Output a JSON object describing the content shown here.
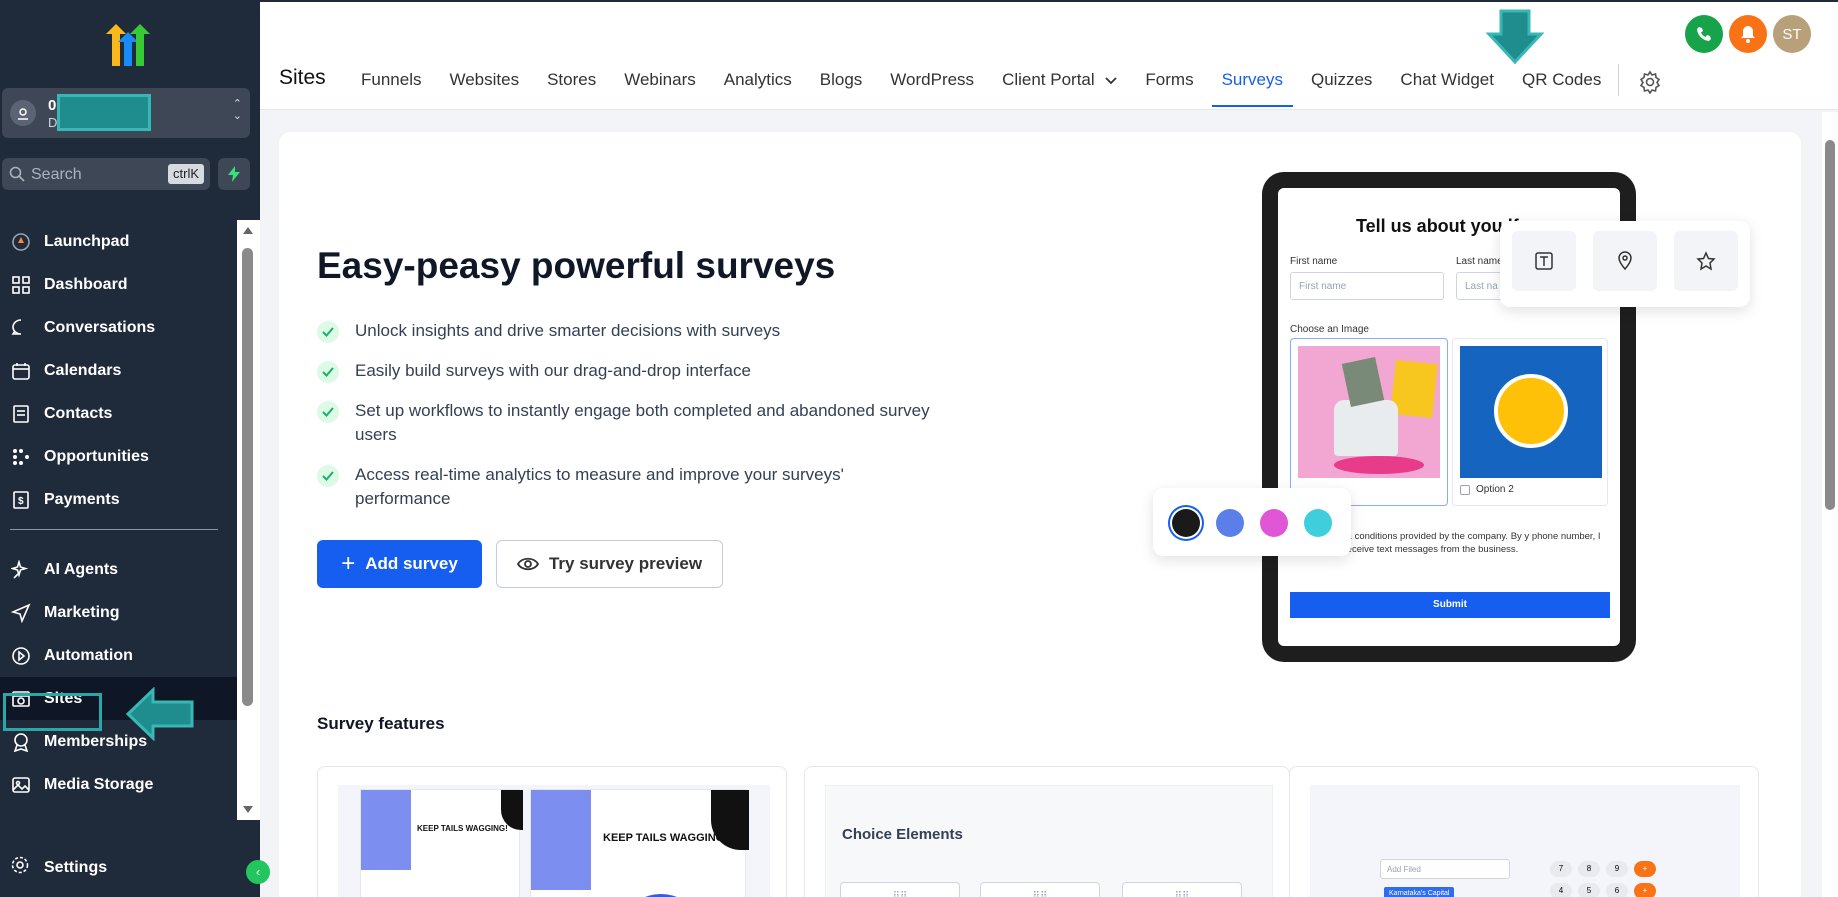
{
  "sidebar": {
    "account": {
      "name": "0",
      "sub": "D"
    },
    "search": {
      "placeholder": "Search",
      "shortcut": "ctrlK"
    },
    "items": [
      {
        "label": "Launchpad",
        "icon": "launchpad-icon"
      },
      {
        "label": "Dashboard",
        "icon": "dashboard-icon"
      },
      {
        "label": "Conversations",
        "icon": "chat-bubble-icon"
      },
      {
        "label": "Calendars",
        "icon": "calendar-icon"
      },
      {
        "label": "Contacts",
        "icon": "contacts-icon"
      },
      {
        "label": "Opportunities",
        "icon": "opportunities-icon"
      },
      {
        "label": "Payments",
        "icon": "payments-icon"
      }
    ],
    "items2": [
      {
        "label": "AI Agents",
        "icon": "ai-sparkle-icon"
      },
      {
        "label": "Marketing",
        "icon": "send-icon"
      },
      {
        "label": "Automation",
        "icon": "play-icon"
      },
      {
        "label": "Sites",
        "icon": "sites-icon",
        "active": true
      },
      {
        "label": "Memberships",
        "icon": "badge-icon"
      },
      {
        "label": "Media Storage",
        "icon": "image-icon"
      }
    ],
    "settings_label": "Settings"
  },
  "header": {
    "title": "Sites",
    "tabs": [
      "Funnels",
      "Websites",
      "Stores",
      "Webinars",
      "Analytics",
      "Blogs",
      "WordPress",
      "Client Portal",
      "Forms",
      "Surveys",
      "Quizzes",
      "Chat Widget",
      "QR Codes"
    ],
    "active_tab": "Surveys",
    "avatar_initials": "ST"
  },
  "hero": {
    "title": "Easy-peasy powerful surveys",
    "bullets": [
      "Unlock insights and drive smarter decisions with surveys",
      "Easily build surveys with our drag-and-drop interface",
      "Set up workflows to instantly engage both completed and abandoned survey users",
      "Access real-time analytics to measure and improve your surveys' performance"
    ],
    "add_label": "Add survey",
    "preview_label": "Try survey preview"
  },
  "mock": {
    "title": "Tell us about you",
    "title_tail": "lf",
    "first_name_label": "First name",
    "first_name_ph": "First name",
    "last_name_label": "Last name",
    "last_name_ph": "Last na",
    "choose_image": "Choose an Image",
    "option2": "Option 2",
    "terms": "he terms & conditions provided by the company. By y phone number, I agree to receive text messages from the business.",
    "submit": "Submit"
  },
  "features": {
    "title": "Survey features",
    "card2_title": "Choice Elements",
    "keep_tails": "KEEP TAILS WAGGING!",
    "card3_field": "Add Filed",
    "card3_tag1": "Karnataka's Capital",
    "keypad": [
      "7",
      "8",
      "9",
      "+",
      "4",
      "5",
      "6",
      "+"
    ]
  },
  "colors": {
    "accent": "#155eef",
    "sidebar": "#1f2a3a",
    "teal": "#2aa8a7",
    "palette": [
      "#1a1a1a",
      "#5b7fe8",
      "#e056d6",
      "#3fcfdc"
    ]
  }
}
